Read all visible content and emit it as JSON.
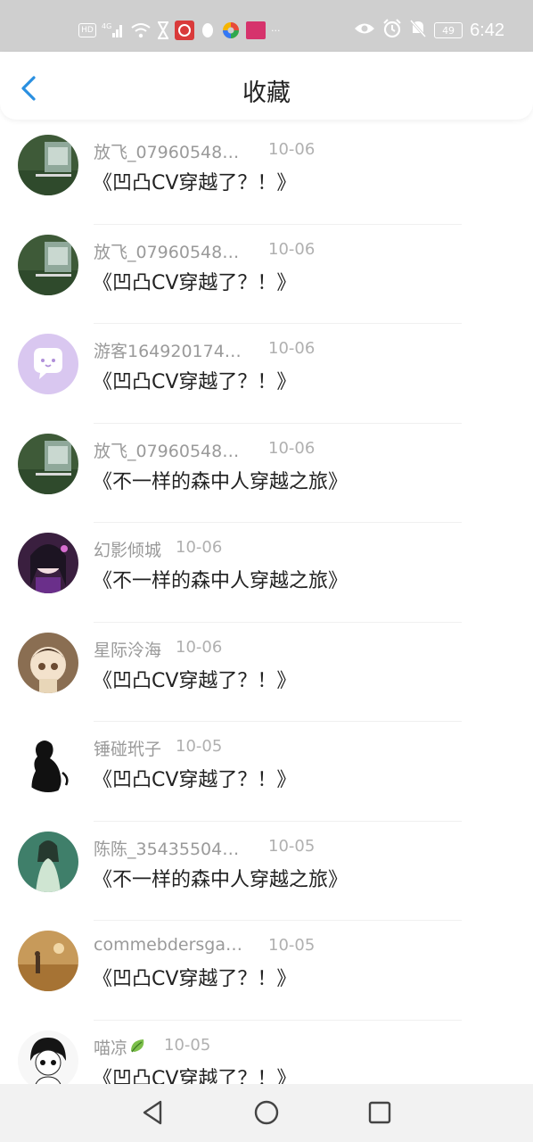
{
  "status_bar": {
    "hd": "HD",
    "signal_label": "4G",
    "battery": "49",
    "time": "6:42",
    "more": "···"
  },
  "header": {
    "title": "收藏"
  },
  "items": [
    {
      "name": "放飞_079605489...",
      "date": "10-06",
      "book": "《凹凸CV穿越了？！》",
      "avatar": "photo-tree"
    },
    {
      "name": "放飞_079605489...",
      "date": "10-06",
      "book": "《凹凸CV穿越了？！》",
      "avatar": "photo-tree"
    },
    {
      "name": "游客1649201747...",
      "date": "10-06",
      "book": "《凹凸CV穿越了？！》",
      "avatar": "default-chat"
    },
    {
      "name": "放飞_079605489...",
      "date": "10-06",
      "book": "《不一样的森中人穿越之旅》",
      "avatar": "photo-tree"
    },
    {
      "name": "幻影倾城",
      "date": "10-06",
      "book": "《不一样的森中人穿越之旅》",
      "avatar": "anime-purple"
    },
    {
      "name": "星际泠海",
      "date": "10-06",
      "book": "《凹凸CV穿越了？！》",
      "avatar": "anime-brown"
    },
    {
      "name": "锤碰玳子",
      "date": "10-05",
      "book": "《凹凸CV穿越了？！》",
      "avatar": "silhouette"
    },
    {
      "name": "陈陈_354355040...",
      "date": "10-05",
      "book": "《不一样的森中人穿越之旅》",
      "avatar": "anime-green"
    },
    {
      "name": "commebdersgarf...",
      "date": "10-05",
      "book": "《凹凸CV穿越了？！》",
      "avatar": "desert"
    },
    {
      "name": "喵凉",
      "date": "10-05",
      "book": "《凹凸CV穿越了？！》",
      "avatar": "sketch-boy"
    }
  ],
  "colors": {
    "accent": "#2a8fe0",
    "status_bar_bg": "#cfcfcf"
  }
}
